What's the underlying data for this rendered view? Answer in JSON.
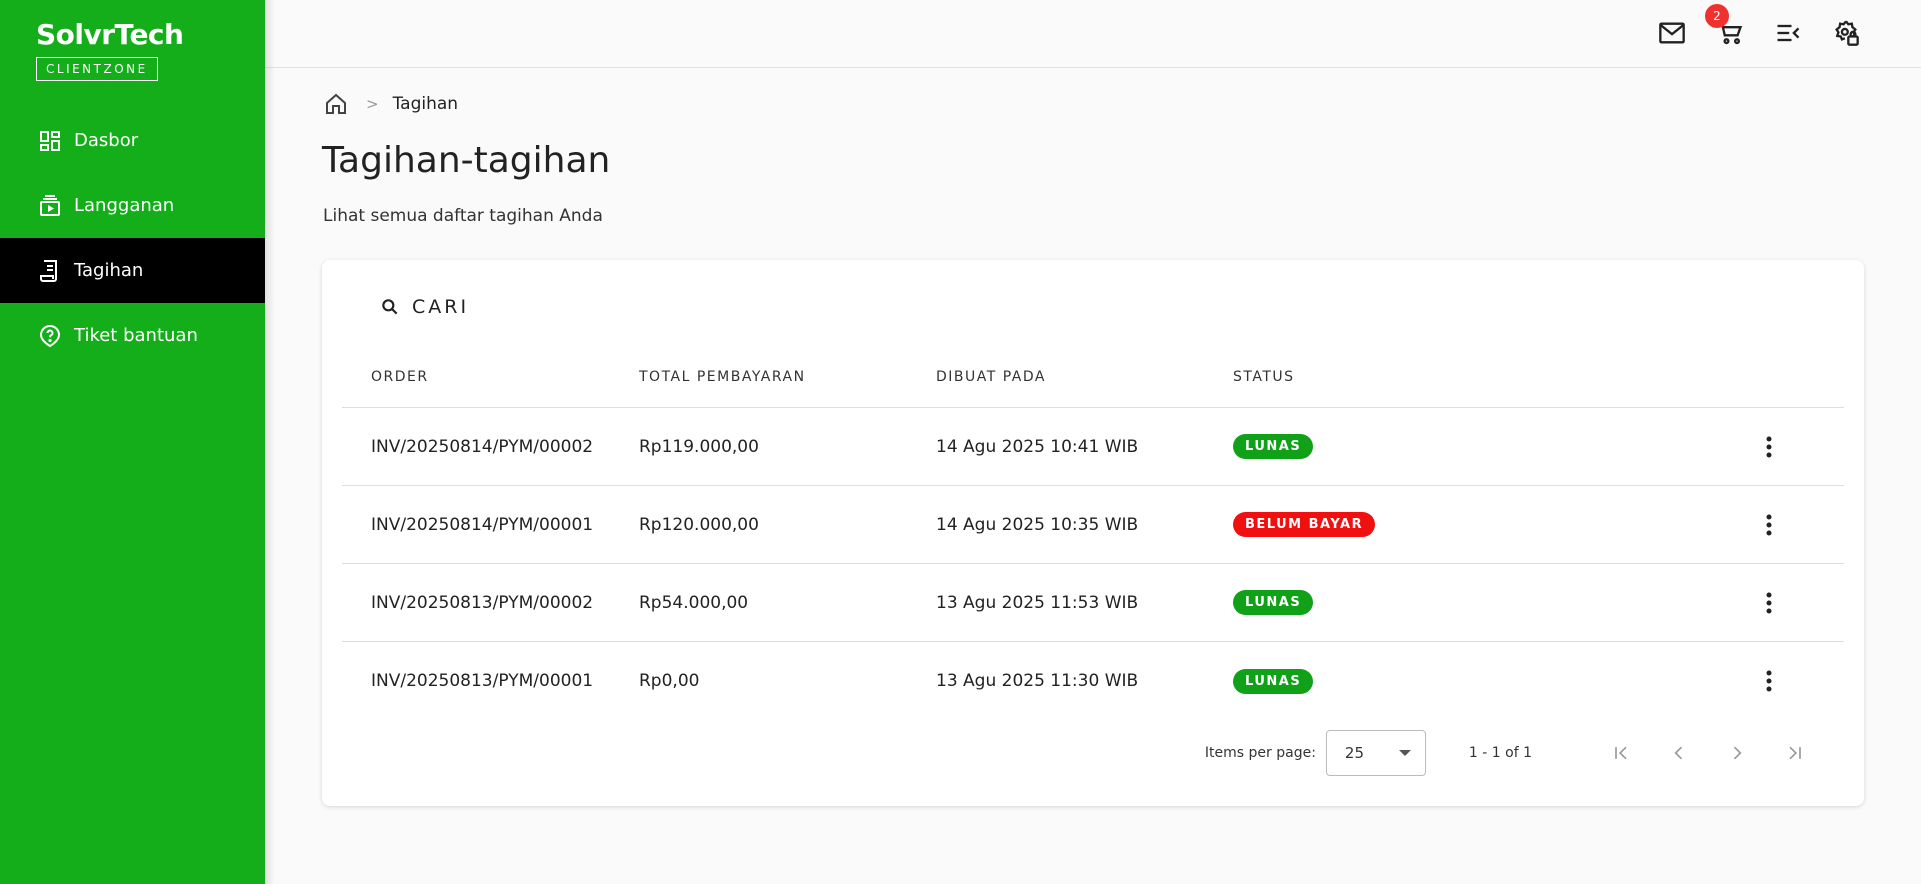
{
  "brand": {
    "name": "SolvrTech",
    "sub": "CLIENTZONE"
  },
  "sidebar": {
    "items": [
      {
        "label": "Dasbor",
        "icon": "dashboard-icon"
      },
      {
        "label": "Langganan",
        "icon": "subscription-icon"
      },
      {
        "label": "Tagihan",
        "icon": "receipt-icon",
        "active": true
      },
      {
        "label": "Tiket bantuan",
        "icon": "help-icon"
      }
    ]
  },
  "topbar": {
    "cart_count": "2"
  },
  "breadcrumb": {
    "current": "Tagihan"
  },
  "page": {
    "title": "Tagihan-tagihan",
    "subtitle": "Lihat semua daftar tagihan Anda"
  },
  "search": {
    "label": "CARI"
  },
  "table": {
    "headers": [
      "ORDER",
      "TOTAL PEMBAYARAN",
      "DIBUAT PADA",
      "STATUS"
    ],
    "rows": [
      {
        "order": "INV/20250814/PYM/00002",
        "total": "Rp119.000,00",
        "created": "14 Agu 2025 10:41 WIB",
        "status": "LUNAS"
      },
      {
        "order": "INV/20250814/PYM/00001",
        "total": "Rp120.000,00",
        "created": "14 Agu 2025 10:35 WIB",
        "status": "BELUM BAYAR"
      },
      {
        "order": "INV/20250813/PYM/00002",
        "total": "Rp54.000,00",
        "created": "13 Agu 2025 11:53 WIB",
        "status": "LUNAS"
      },
      {
        "order": "INV/20250813/PYM/00001",
        "total": "Rp0,00",
        "created": "13 Agu 2025 11:30 WIB",
        "status": "LUNAS"
      }
    ]
  },
  "pagination": {
    "items_per_page_label": "Items per page:",
    "items_per_page": "25",
    "range": "1 - 1 of 1"
  },
  "colors": {
    "sidebar": "#14ae1a",
    "paid": "#10a118",
    "unpaid": "#f01010",
    "badge": "#f0312d"
  }
}
